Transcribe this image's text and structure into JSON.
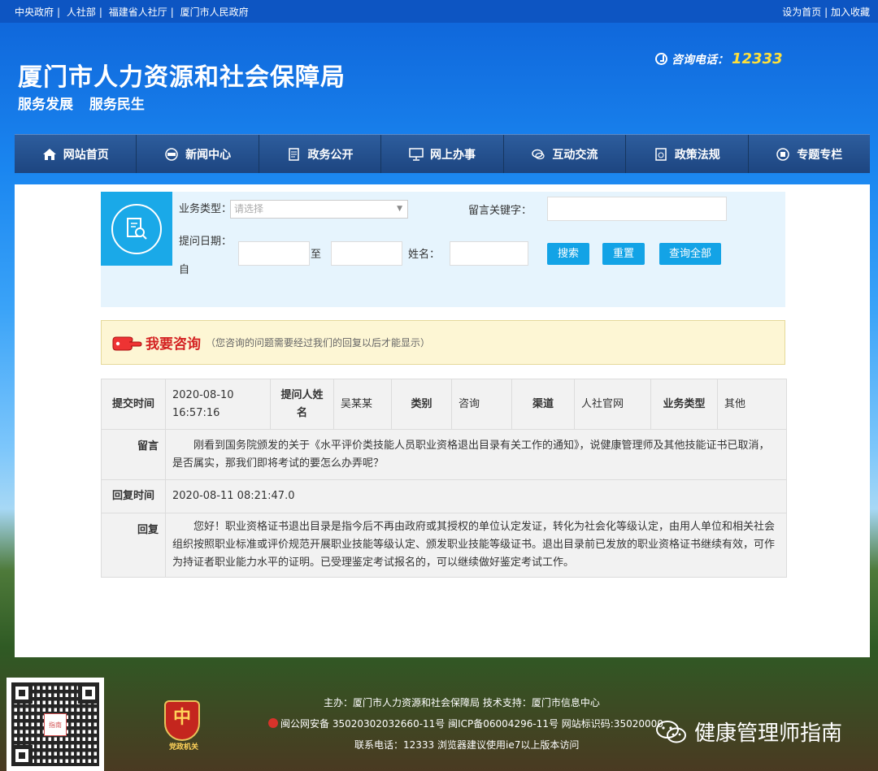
{
  "topbar": {
    "links": [
      "中央政府",
      "人社部",
      "福建省人社厅",
      "厦门市人民政府"
    ],
    "set_home": "设为首页",
    "separator": "|",
    "add_fav": "加入收藏"
  },
  "header": {
    "title": "厦门市人力资源和社会保障局",
    "slogan": "服务发展  服务民生",
    "hotline_label": "咨询电话：",
    "hotline_number": "12333"
  },
  "nav": {
    "items": [
      {
        "label": "网站首页",
        "icon": "home-icon"
      },
      {
        "label": "新闻中心",
        "icon": "news-icon"
      },
      {
        "label": "政务公开",
        "icon": "document-icon"
      },
      {
        "label": "网上办事",
        "icon": "monitor-icon"
      },
      {
        "label": "互动交流",
        "icon": "chat-icon"
      },
      {
        "label": "政策法规",
        "icon": "policy-icon"
      },
      {
        "label": "专题专栏",
        "icon": "topic-icon"
      }
    ]
  },
  "search": {
    "business_type_label": "业务类型：",
    "business_type_placeholder": "请选择",
    "keyword_label": "留言关键字：",
    "date_label": "提问日期：",
    "date_from": "自",
    "date_to": "至",
    "name_label": "姓名：",
    "search_button": "搜索",
    "reset_button": "重置",
    "query_all_button": "查询全部"
  },
  "consult": {
    "title": "我要咨询",
    "note": "（您咨询的问题需要经过我们的回复以后才能显示）"
  },
  "detail": {
    "submit_time_label": "提交时间",
    "submit_date": "2020-08-10",
    "submit_clock": "16:57:16",
    "asker_label": "提问人姓名",
    "asker_value": "吴某某",
    "category_label": "类别",
    "category_value": "咨询",
    "channel_label": "渠道",
    "channel_value": "人社官网",
    "biz_type_label": "业务类型",
    "biz_type_value": "其他",
    "message_label": "留言",
    "message_value": "　　刚看到国务院颁发的关于《水平评价类技能人员职业资格退出目录有关工作的通知》，说健康管理师及其他技能证书已取消，是否属实，那我们即将考试的要怎么办弄呢？",
    "reply_time_label": "回复时间",
    "reply_time_value": "2020-08-11 08:21:47.0",
    "reply_label": "回复",
    "reply_value": "　　您好！职业资格证书退出目录是指今后不再由政府或其授权的单位认定发证，转化为社会化等级认定，由用人单位和相关社会组织按照职业标准或评价规范开展职业技能等级认定、颁发职业技能等级证书。退出目录前已发放的职业资格证书继续有效，可作为持证者职业能力水平的证明。已受理鉴定考试报名的，可以继续做好鉴定考试工作。"
  },
  "footer": {
    "sponsor": "主办：厦门市人力资源和社会保障局 技术支持：厦门市信息中心",
    "icp": "闽公网安备 35020302032660-11号 闽ICP备06004296-11号 网站标识码:35020000",
    "contact": "联系电话：12333 浏览器建议使用ie7以上版本访问",
    "emblem_label": "党政机关",
    "emblem_glyph": "中",
    "qr_logo": "指南",
    "wechat_name": "健康管理师指南"
  }
}
